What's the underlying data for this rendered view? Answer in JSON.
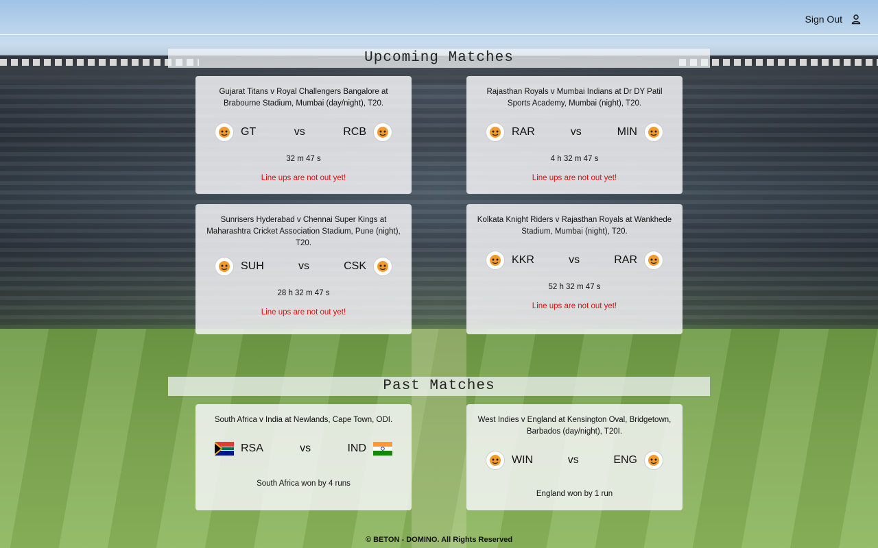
{
  "header": {
    "sign_out_label": "Sign Out"
  },
  "upcoming": {
    "title": "Upcoming Matches",
    "matches": [
      {
        "title": "Gujarat Titans v Royal Challengers Bangalore at Brabourne Stadium, Mumbai (day/night), T20.",
        "team1": "GT",
        "team2": "RCB",
        "vs": "vs",
        "countdown": "32 m 47 s",
        "lineup": "Line ups are not out yet!"
      },
      {
        "title": "Rajasthan Royals v Mumbai Indians at Dr DY Patil Sports Academy, Mumbai (night), T20.",
        "team1": "RAR",
        "team2": "MIN",
        "vs": "vs",
        "countdown": "4 h 32 m 47 s",
        "lineup": "Line ups are not out yet!"
      },
      {
        "title": "Sunrisers Hyderabad v Chennai Super Kings at Maharashtra Cricket Association Stadium, Pune (night), T20.",
        "team1": "SUH",
        "team2": "CSK",
        "vs": "vs",
        "countdown": "28 h 32 m 47 s",
        "lineup": "Line ups are not out yet!"
      },
      {
        "title": "Kolkata Knight Riders v Rajasthan Royals at Wankhede Stadium, Mumbai (night), T20.",
        "team1": "KKR",
        "team2": "RAR",
        "vs": "vs",
        "countdown": "52 h 32 m 47 s",
        "lineup": "Line ups are not out yet!"
      }
    ]
  },
  "past": {
    "title": "Past Matches",
    "matches": [
      {
        "title": "South Africa v India at Newlands, Cape Town, ODI.",
        "team1": "RSA",
        "team2": "IND",
        "vs": "vs",
        "result": "South Africa won by 4 runs"
      },
      {
        "title": "West Indies v England at Kensington Oval, Bridgetown, Barbados (day/night), T20I.",
        "team1": "WIN",
        "team2": "ENG",
        "vs": "vs",
        "result": "England won by 1 run"
      }
    ]
  },
  "footer": {
    "text": "© BETON - DOMINO. All Rights Reserved"
  },
  "colors": {
    "lineup_warning": "#e01010"
  }
}
